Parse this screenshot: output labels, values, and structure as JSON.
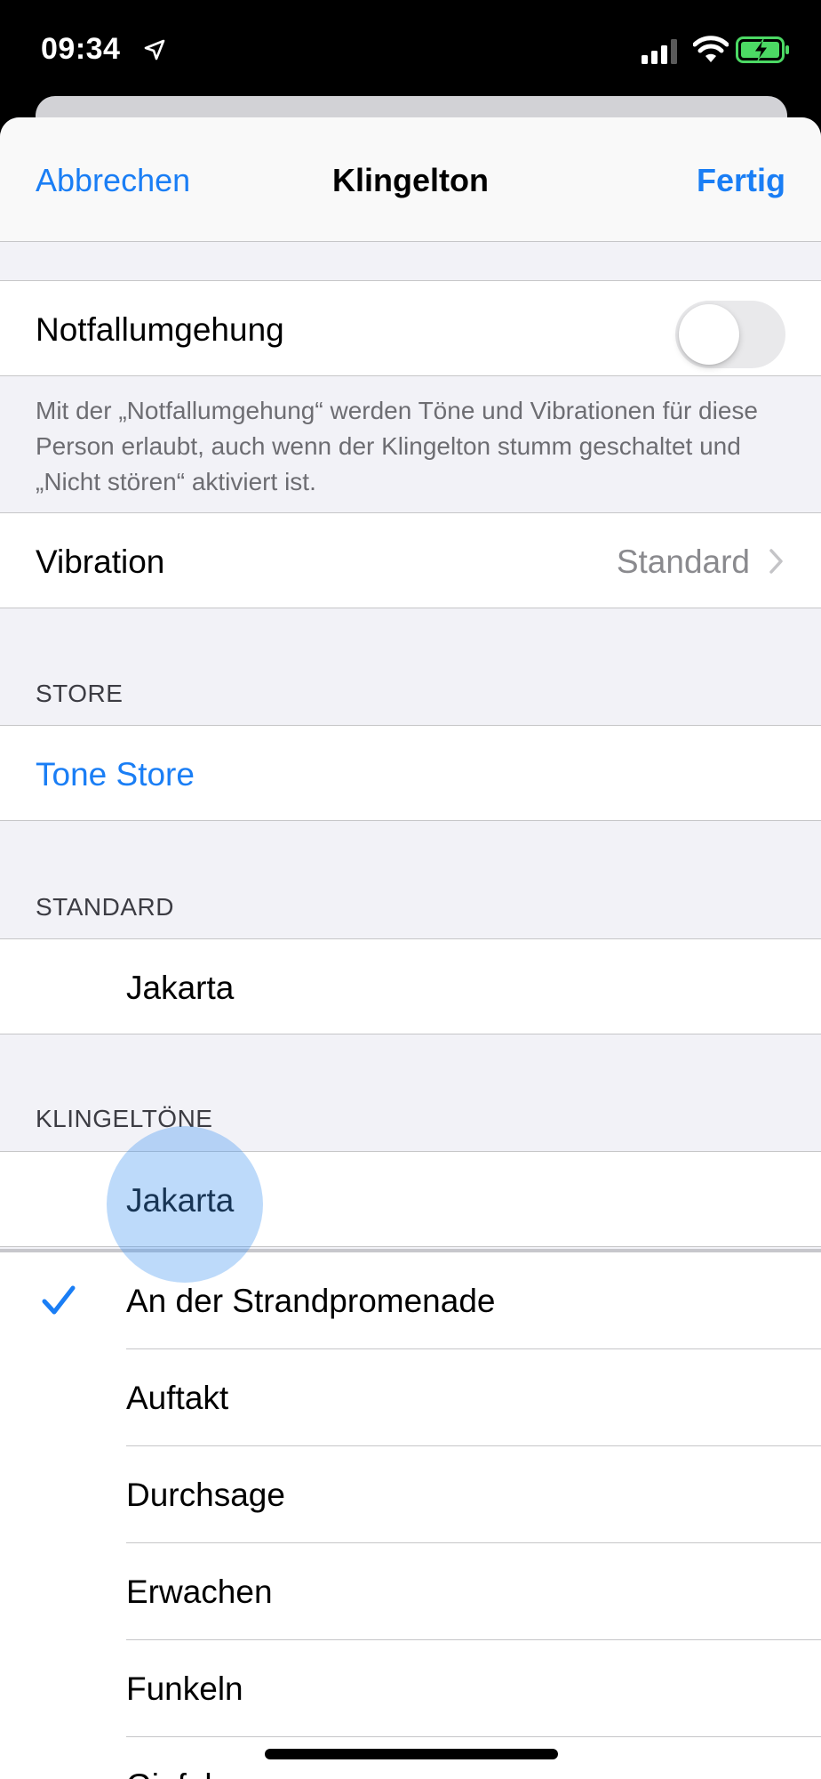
{
  "status": {
    "time": "09:34",
    "icons": [
      "location-icon",
      "signal-icon",
      "wifi-icon",
      "battery-charging-icon"
    ]
  },
  "nav": {
    "cancel": "Abbrechen",
    "title": "Klingelton",
    "done": "Fertig"
  },
  "emergency": {
    "label": "Notfallumgehung",
    "enabled": false,
    "note": "Mit der „Notfallumgehung“ werden Töne und Vibrationen für diese Person erlaubt, auch wenn der Klingelton stumm geschaltet und „Nicht stören“ aktiviert ist."
  },
  "vibration": {
    "label": "Vibration",
    "value": "Standard"
  },
  "store": {
    "header": "STORE",
    "link": "Tone Store"
  },
  "standard": {
    "header": "STANDARD",
    "item": "Jakarta"
  },
  "ringtones": {
    "header": "KLINGELTÖNE",
    "top_item": "Jakarta",
    "items": [
      "An der Strandpromenade",
      "Auftakt",
      "Durchsage",
      "Erwachen",
      "Funkeln",
      "Gipfel"
    ],
    "selected": "An der Strandpromenade"
  },
  "colors": {
    "accent": "#1a7ef5",
    "background": "#f2f2f7",
    "secondary_text": "#6d6d72",
    "toggle_off": "#e9e9eb"
  }
}
